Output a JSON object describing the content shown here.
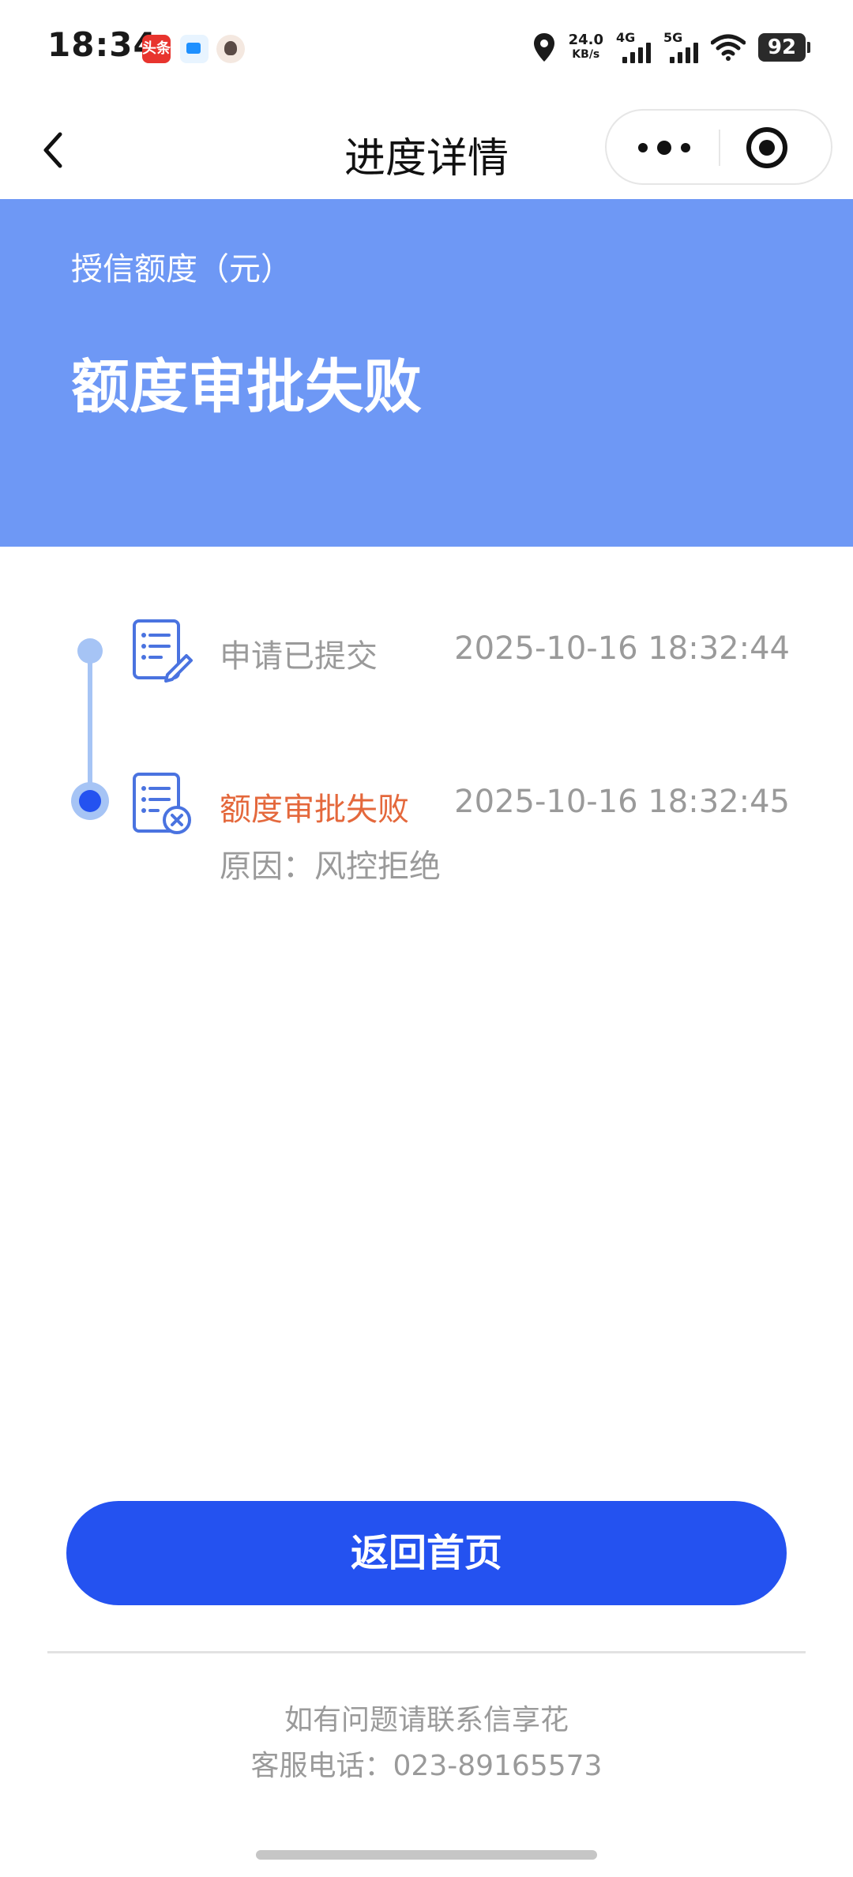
{
  "status_bar": {
    "time": "18:34",
    "app_badge_1": "头条",
    "speed_value": "24.0",
    "speed_unit": "KB/s",
    "net_1": "4G",
    "net_2": "5G",
    "battery": "92"
  },
  "nav": {
    "title": "进度详情",
    "back_icon": "chevron-left-icon",
    "more_icon": "more-dots-icon",
    "close_icon": "target-close-icon"
  },
  "banner": {
    "label": "授信额度（元）",
    "status": "额度审批失败",
    "color": "#6e98f5"
  },
  "timeline": {
    "items": [
      {
        "title": "申请已提交",
        "time": "2025-10-16 18:32:44",
        "icon": "document-edit-icon"
      },
      {
        "title": "额度审批失败",
        "time": "2025-10-16 18:32:45",
        "reason": "原因：风控拒绝",
        "icon": "document-reject-icon",
        "title_color": "#e4683c"
      }
    ]
  },
  "actions": {
    "home_button": "返回首页",
    "button_color": "#2452f0"
  },
  "footer": {
    "line1": "如有问题请联系信享花",
    "line2": "客服电话：023-89165573"
  }
}
